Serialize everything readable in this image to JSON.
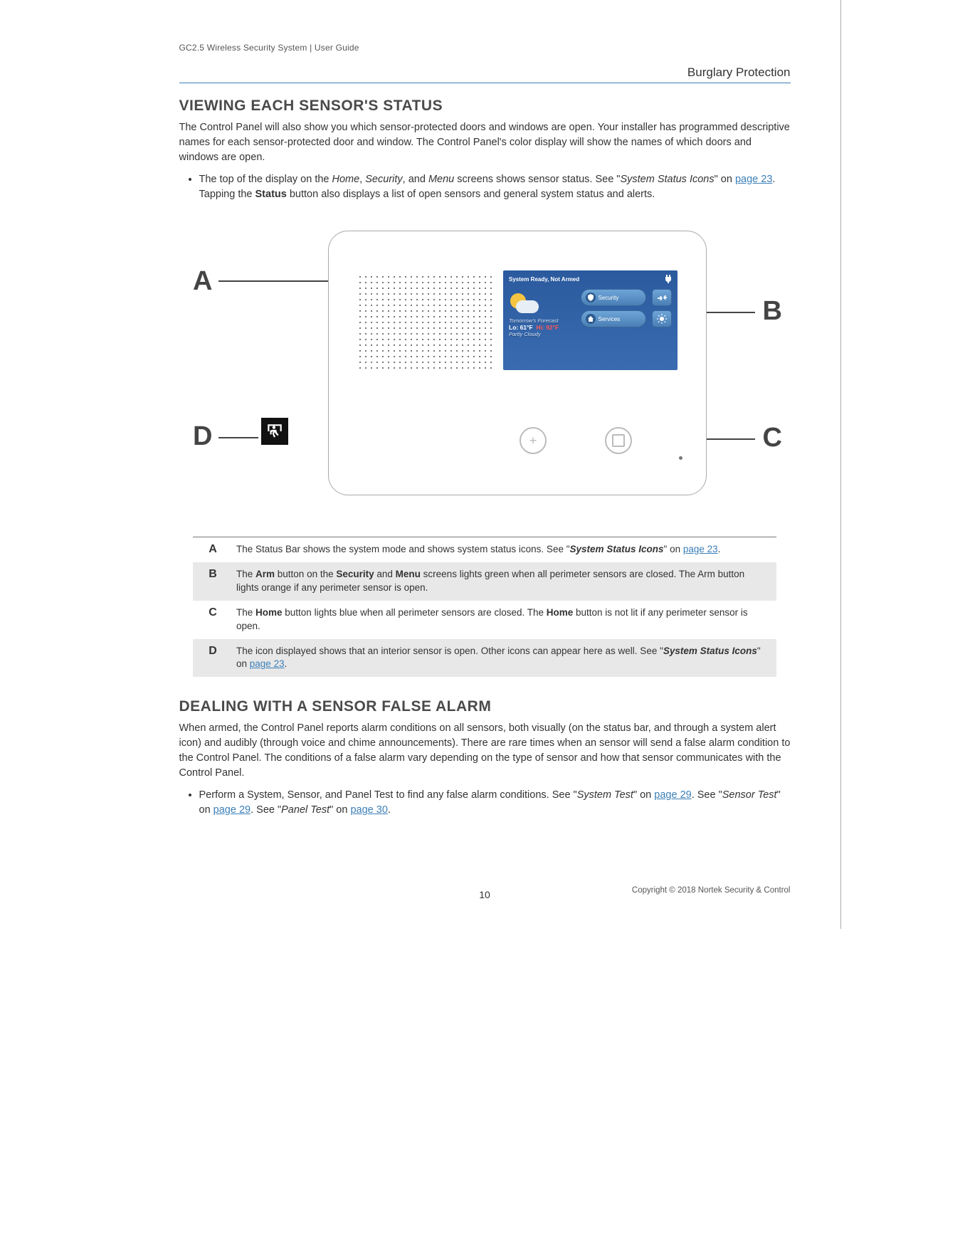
{
  "header": {
    "doc_title": "GC2.5 Wireless Security System | User Guide",
    "section": "Burglary Protection"
  },
  "sec1": {
    "heading": "VIEWING EACH SENSOR'S STATUS",
    "intro": "The Control Panel will also show you which sensor-protected doors and windows are open. Your installer has programmed descriptive names for each sensor-protected door and window. The Control Panel's color display will show the names of which doors and windows are open.",
    "bullet_pre": "The top of the display on the ",
    "bullet_home": "Home",
    "bullet_sep1": ", ",
    "bullet_security": "Security",
    "bullet_sep2": ", and ",
    "bullet_menu": "Menu",
    "bullet_mid": " screens shows sensor status. See \"",
    "bullet_ssi": "System Status Icons",
    "bullet_on": "\" on ",
    "bullet_link": "page 23",
    "bullet_post1": ". Tapping the ",
    "bullet_status": "Status",
    "bullet_post2": " button also displays a list of open sensors and general system status and alerts."
  },
  "figure": {
    "labels": {
      "A": "A",
      "B": "B",
      "C": "C",
      "D": "D"
    },
    "screen": {
      "status_text": "System Ready, Not Armed",
      "forecast_label": "Tomorrow's Forecast",
      "lo_label": "Lo: ",
      "lo_val": "61°F",
      "hi_label": "Hi: ",
      "hi_val": "92°F",
      "condition": "Partly Cloudy",
      "btn1": "Security",
      "btn2": "Services"
    }
  },
  "legend": {
    "A": {
      "pre": "The Status Bar shows the system mode and shows system status icons. See \"",
      "ssi": "System Status Icons",
      "on": "\" on ",
      "link": "page 23",
      "post": "."
    },
    "B": {
      "pre": "The ",
      "arm": "Arm",
      "mid1": " button on the ",
      "sec": "Security",
      "mid2": " and ",
      "menu": "Menu",
      "post": " screens lights green when all perimeter sensors are closed. The Arm button lights orange if any perimeter sensor is open."
    },
    "C": {
      "pre": "The ",
      "home1": "Home",
      "mid": " button lights blue when all perimeter sensors are closed. The ",
      "home2": "Home",
      "post": " button is not lit if any perimeter sensor is open."
    },
    "D": {
      "pre": "The icon displayed shows that an interior sensor is open. Other icons can appear here as well. See \"",
      "ssi": "System Status Icons",
      "on": "\" on ",
      "link": "page 23",
      "post": "."
    }
  },
  "sec2": {
    "heading": "DEALING WITH A SENSOR FALSE ALARM",
    "intro": "When armed, the Control Panel reports alarm conditions on all sensors, both visually (on the status bar, and through a system alert icon) and audibly (through voice and chime announcements). There are rare times when an sensor will send a false alarm condition to the Control Panel. The conditions of a false alarm vary depending on the type of sensor and how that sensor communicates with the Control Panel.",
    "bullet_pre": "Perform a System, Sensor, and Panel Test to find any false alarm conditions. See \"",
    "bullet_st": "System Test",
    "bullet_on1": "\" on ",
    "bullet_link1": "page 29",
    "bullet_see1": ". See \"",
    "bullet_sensor": "Sensor Test",
    "bullet_on2": "\" on ",
    "bullet_link2": "page 29",
    "bullet_see2": ". See \"",
    "bullet_panel": "Panel Test",
    "bullet_on3": "\" on ",
    "bullet_link3": "page 30",
    "bullet_post": "."
  },
  "footer": {
    "pagenum": "10",
    "copyright": "Copyright ©  2018 Nortek Security & Control"
  }
}
